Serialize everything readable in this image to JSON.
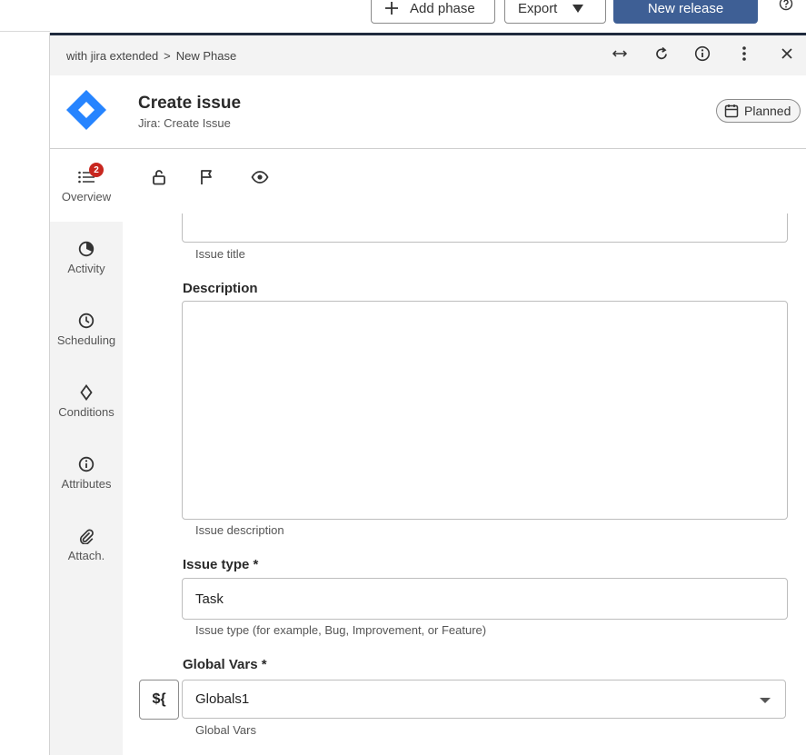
{
  "toolbar": {
    "add_phase_label": "Add phase",
    "export_label": "Export",
    "new_release_label": "New release"
  },
  "breadcrumb": {
    "parent": "with jira extended",
    "separator": ">",
    "current": "New Phase"
  },
  "task": {
    "title": "Create issue",
    "subtitle": "Jira: Create Issue",
    "status": "Planned"
  },
  "sidetabs": [
    {
      "label": "Overview",
      "icon": "list-icon",
      "badge": "2"
    },
    {
      "label": "Activity",
      "icon": "activity-icon"
    },
    {
      "label": "Scheduling",
      "icon": "clock-icon"
    },
    {
      "label": "Conditions",
      "icon": "diamond-icon"
    },
    {
      "label": "Attributes",
      "icon": "info-icon"
    },
    {
      "label": "Attach.",
      "icon": "paperclip-icon"
    }
  ],
  "form": {
    "title_helper": "Issue title",
    "description_label": "Description",
    "description_value": "",
    "description_helper": "Issue description",
    "issue_type_label": "Issue type *",
    "issue_type_value": "Task",
    "issue_type_helper": "Issue type (for example, Bug, Improvement, or Feature)",
    "global_vars_label": "Global Vars *",
    "global_vars_value": "Globals1",
    "global_vars_helper": "Global Vars",
    "variable_button_label": "${"
  },
  "colors": {
    "primary": "#3e5f95",
    "badge_red": "#c8271f",
    "jira_blue": "#2684ff"
  }
}
